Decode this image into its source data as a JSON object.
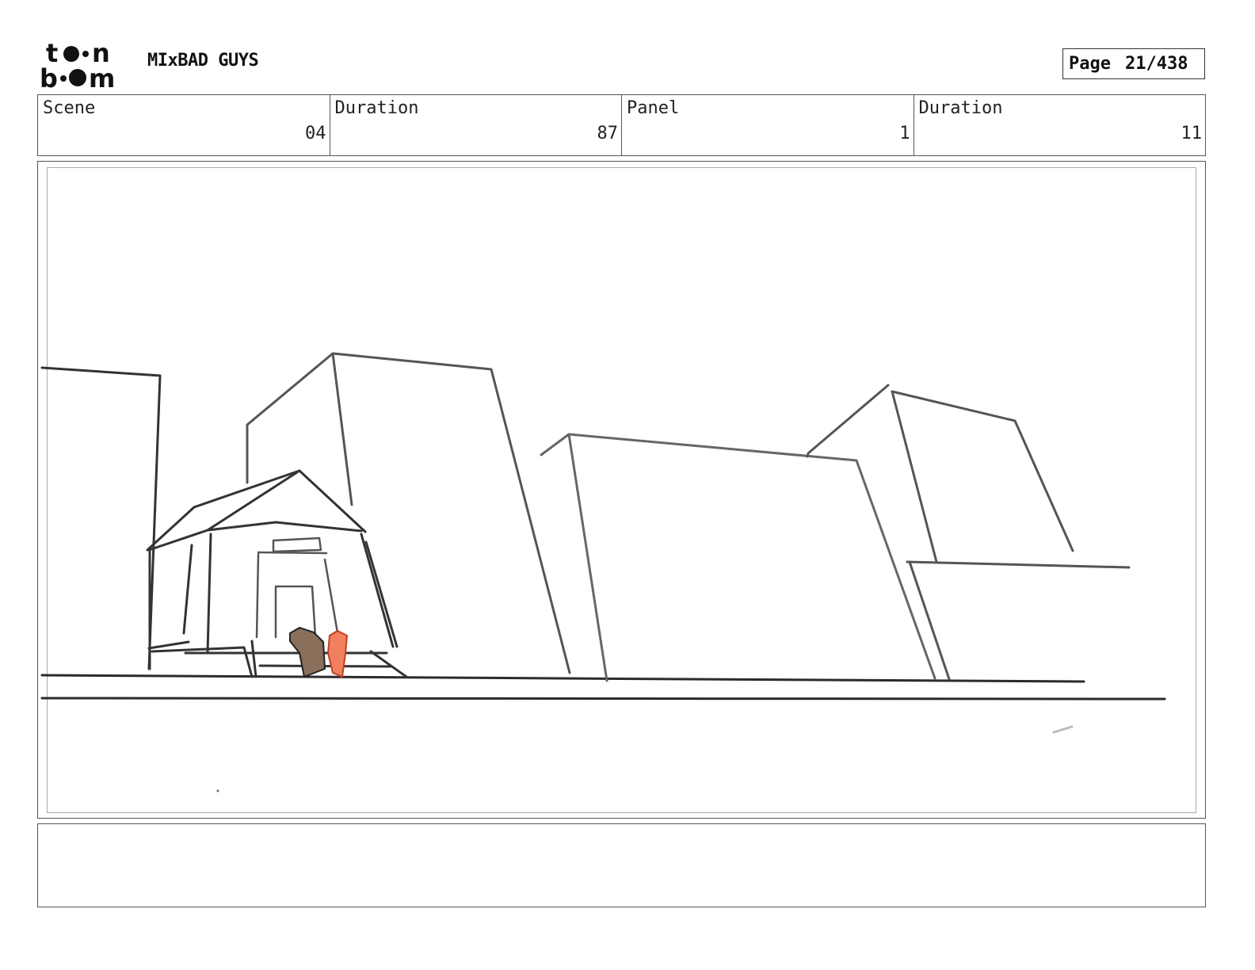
{
  "header": {
    "logo_text": "toon boom",
    "project_title": "MIxBAD GUYS",
    "page_label": "Page",
    "page_number": "21/438"
  },
  "info": {
    "scene_label": "Scene",
    "scene_value": "04",
    "scene_duration_label": "Duration",
    "scene_duration_value": "87",
    "panel_label": "Panel",
    "panel_value": "1",
    "panel_duration_label": "Duration",
    "panel_duration_value": "11"
  },
  "notes": {
    "text": ""
  },
  "colors": {
    "sketch_line": "#333333",
    "character_brown": "#8a6f5a",
    "character_orange": "#f08060"
  }
}
